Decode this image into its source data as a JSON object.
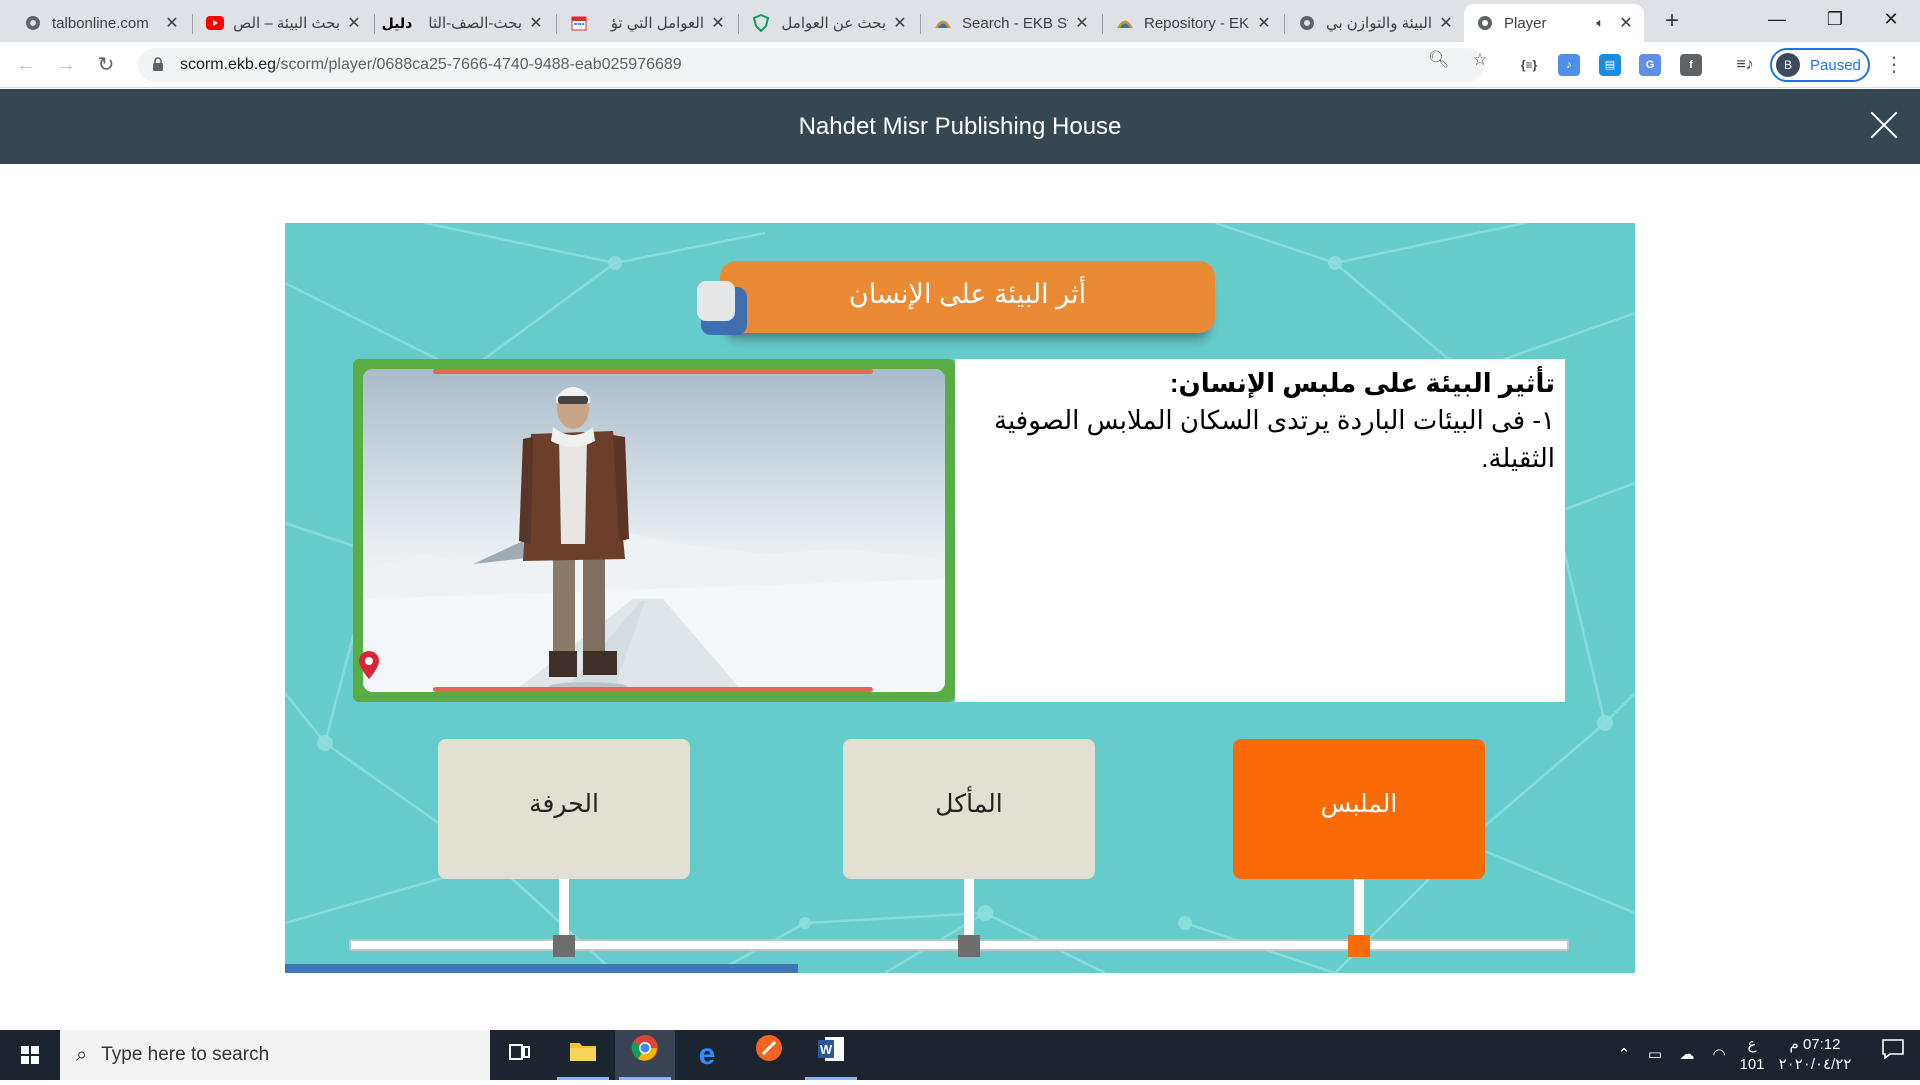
{
  "browser": {
    "tabs": [
      {
        "title": "talbonline.com",
        "icon": "globe-icon"
      },
      {
        "title": "بحث البيئة – الص",
        "icon": "youtube-icon"
      },
      {
        "title": "بحث-الصف-الثا",
        "icon": "dalil-logo-icon"
      },
      {
        "title": "العوامل التي تؤ",
        "icon": "calendar-icon"
      },
      {
        "title": "بحث عن العوامل",
        "icon": "shield-icon"
      },
      {
        "title": "Search - EKB St",
        "icon": "ekb-icon"
      },
      {
        "title": "Repository - EK",
        "icon": "ekb-icon"
      },
      {
        "title": "البيئة والتوازن بي",
        "icon": "globe-icon"
      },
      {
        "title": "Player",
        "icon": "globe-icon",
        "active": true
      }
    ],
    "url_domain": "scorm.ekb.eg",
    "url_path": "/scorm/player/0688ca25-7666-4740-9488-eab025976689",
    "profile_initial": "B",
    "profile_status": "Paused"
  },
  "player": {
    "header_title": "Nahdet Misr Publishing House"
  },
  "lesson": {
    "title": "أثر البيئة على الإنسان",
    "section_heading": "تأثير البيئة على ملبس الإنسان:",
    "section_text": "١- فى البيئات الباردة يرتدى السكان الملابس الصوفية الثقيلة.",
    "image_alt": "man in winter clothing standing on a snowy road",
    "timeline": [
      {
        "label": "الحرفة",
        "active": false
      },
      {
        "label": "المأكل",
        "active": false
      },
      {
        "label": "الملبس",
        "active": true
      }
    ],
    "progress_fraction": 0.38,
    "colors": {
      "stage_bg": "#65cccb",
      "title_pill": "#ea8a35",
      "active_card": "#fa6b08",
      "inactive_card": "#e2dfd3",
      "image_frame": "#5aad44",
      "progress": "#3d78b3"
    }
  },
  "taskbar": {
    "search_placeholder": "Type here to search",
    "clock_time": "07:12 م",
    "clock_date": "٢٠٢٠/٠٤/٢٢",
    "lang_indicator": "ع",
    "tray_count": "101"
  }
}
